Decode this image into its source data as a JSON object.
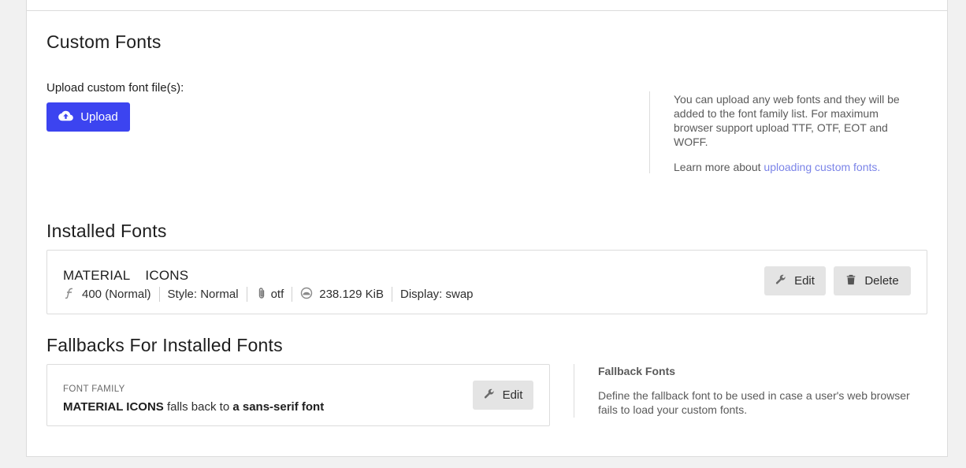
{
  "custom_fonts": {
    "title": "Custom Fonts",
    "upload_label": "Upload custom font file(s):",
    "upload_button": "Upload",
    "upload_icon": "cloud-upload-icon",
    "help_text": "You can upload any web fonts and they will be added to the font family list. For maximum browser support upload TTF, OTF, EOT and WOFF.",
    "learn_more_prefix": "Learn more about ",
    "learn_more_link": "uploading custom fonts."
  },
  "installed_fonts": {
    "title": "Installed Fonts",
    "font": {
      "name": "MATERIAL    ICONS",
      "weight": "400 (Normal)",
      "style": "Style: Normal",
      "format": "otf",
      "size": "238.129 KiB",
      "display": "Display: swap"
    },
    "edit_button": "Edit",
    "delete_button": "Delete"
  },
  "fallbacks": {
    "title": "Fallbacks For Installed Fonts",
    "kicker": "FONT FAMILY",
    "family": "MATERIAL ICONS",
    "falls_back_to": "falls back to",
    "fallback": "a sans-serif font",
    "edit_button": "Edit",
    "side_title": "Fallback Fonts",
    "side_text": "Define the fallback font to be used in case a user's web browser fails to load your custom fonts."
  },
  "colors": {
    "primary": "#3c44f0",
    "link": "#7b84e8",
    "button_gray": "#e4e4e4",
    "border": "#dcdcdc",
    "background": "#f1f1f1"
  }
}
